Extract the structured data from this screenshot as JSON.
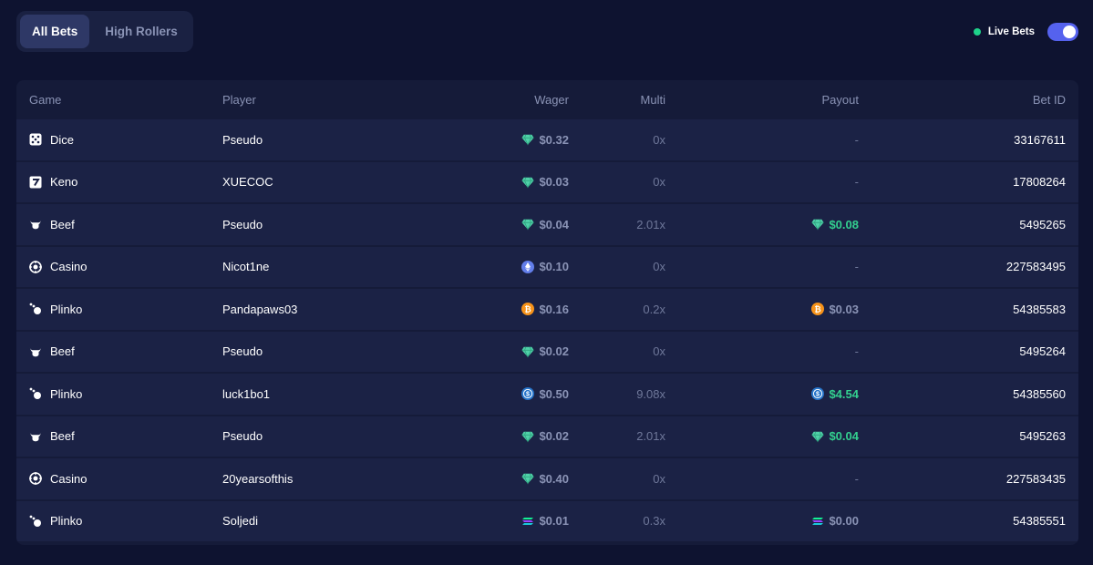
{
  "tabs": [
    {
      "label": "All Bets",
      "active": true
    },
    {
      "label": "High Rollers",
      "active": false
    }
  ],
  "live_bets": {
    "label": "Live Bets",
    "enabled": true,
    "dot_color": "#1ed28a",
    "toggle_color": "#5562ee"
  },
  "columns": {
    "game": "Game",
    "player": "Player",
    "wager": "Wager",
    "multi": "Multi",
    "payout": "Payout",
    "bet_id": "Bet ID"
  },
  "rows": [
    {
      "game": "Dice",
      "game_icon": "dice-icon",
      "player": "Pseudo",
      "wager": "$0.32",
      "wager_icon": "gem-icon",
      "multi": "0x",
      "payout": "-",
      "payout_icon": "",
      "payout_win": false,
      "bet_id": "33167611"
    },
    {
      "game": "Keno",
      "game_icon": "keno-icon",
      "player": "XUECOC",
      "wager": "$0.03",
      "wager_icon": "gem-icon",
      "multi": "0x",
      "payout": "-",
      "payout_icon": "",
      "payout_win": false,
      "bet_id": "17808264"
    },
    {
      "game": "Beef",
      "game_icon": "bull-icon",
      "player": "Pseudo",
      "wager": "$0.04",
      "wager_icon": "gem-icon",
      "multi": "2.01x",
      "payout": "$0.08",
      "payout_icon": "gem-icon",
      "payout_win": true,
      "bet_id": "5495265"
    },
    {
      "game": "Casino",
      "game_icon": "casino-chip-icon",
      "player": "Nicot1ne",
      "wager": "$0.10",
      "wager_icon": "ethereum-icon",
      "multi": "0x",
      "payout": "-",
      "payout_icon": "",
      "payout_win": false,
      "bet_id": "227583495"
    },
    {
      "game": "Plinko",
      "game_icon": "plinko-icon",
      "player": "Pandapaws03",
      "wager": "$0.16",
      "wager_icon": "bitcoin-icon",
      "multi": "0.2x",
      "payout": "$0.03",
      "payout_icon": "bitcoin-icon",
      "payout_win": false,
      "bet_id": "54385583"
    },
    {
      "game": "Beef",
      "game_icon": "bull-icon",
      "player": "Pseudo",
      "wager": "$0.02",
      "wager_icon": "gem-icon",
      "multi": "0x",
      "payout": "-",
      "payout_icon": "",
      "payout_win": false,
      "bet_id": "5495264"
    },
    {
      "game": "Plinko",
      "game_icon": "plinko-icon",
      "player": "luck1bo1",
      "wager": "$0.50",
      "wager_icon": "usdc-icon",
      "multi": "9.08x",
      "payout": "$4.54",
      "payout_icon": "usdc-icon",
      "payout_win": true,
      "bet_id": "54385560"
    },
    {
      "game": "Beef",
      "game_icon": "bull-icon",
      "player": "Pseudo",
      "wager": "$0.02",
      "wager_icon": "gem-icon",
      "multi": "2.01x",
      "payout": "$0.04",
      "payout_icon": "gem-icon",
      "payout_win": true,
      "bet_id": "5495263"
    },
    {
      "game": "Casino",
      "game_icon": "casino-chip-icon",
      "player": "20yearsofthis",
      "wager": "$0.40",
      "wager_icon": "gem-icon",
      "multi": "0x",
      "payout": "-",
      "payout_icon": "",
      "payout_win": false,
      "bet_id": "227583435"
    },
    {
      "game": "Plinko",
      "game_icon": "plinko-icon",
      "player": "Soljedi",
      "wager": "$0.01",
      "wager_icon": "solana-icon",
      "multi": "0.3x",
      "payout": "$0.00",
      "payout_icon": "solana-icon",
      "payout_win": false,
      "bet_id": "54385551"
    }
  ],
  "colors": {
    "background": "#0e1330",
    "panel": "#151b39",
    "row": "#1b2245",
    "muted": "#8a93b5",
    "win": "#33d08f",
    "gem": "#4fd1a8",
    "bitcoin": "#f7931a",
    "ethereum": "#627eea",
    "usdc": "#2775ca"
  }
}
